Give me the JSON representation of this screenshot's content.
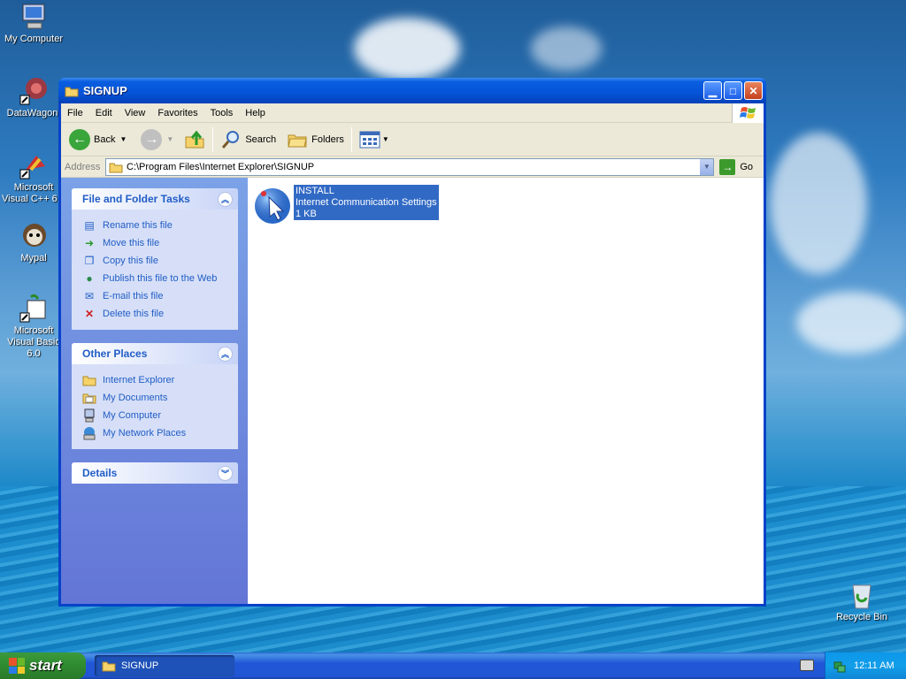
{
  "desktop": {
    "icons": [
      {
        "label": "My Computer",
        "icon": "computer-icon"
      },
      {
        "label": "DataWagon.",
        "icon": "datawagon-icon"
      },
      {
        "label": "Microsoft Visual C++ 6.0",
        "icon": "visual-cpp-icon"
      },
      {
        "label": "Mypal",
        "icon": "mypal-icon"
      },
      {
        "label": "Microsoft Visual Basic 6.0",
        "icon": "visual-basic-icon"
      },
      {
        "label": "Recycle Bin",
        "icon": "recycle-bin-icon"
      }
    ]
  },
  "window": {
    "title": "SIGNUP",
    "menu": [
      "File",
      "Edit",
      "View",
      "Favorites",
      "Tools",
      "Help"
    ],
    "toolbar": {
      "back": "Back",
      "search": "Search",
      "folders": "Folders"
    },
    "address": {
      "label": "Address",
      "value": "C:\\Program Files\\Internet Explorer\\SIGNUP",
      "go": "Go"
    },
    "panels": {
      "file_tasks": {
        "title": "File and Folder Tasks",
        "items": [
          "Rename this file",
          "Move this file",
          "Copy this file",
          "Publish this file to the Web",
          "E-mail this file",
          "Delete this file"
        ]
      },
      "other_places": {
        "title": "Other Places",
        "items": [
          "Internet Explorer",
          "My Documents",
          "My Computer",
          "My Network Places"
        ]
      },
      "details": {
        "title": "Details"
      }
    },
    "file": {
      "name": "INSTALL",
      "type": "Internet Communication Settings",
      "size": "1 KB"
    }
  },
  "taskbar": {
    "start": "start",
    "task": "SIGNUP",
    "clock": "12:11 AM"
  },
  "colors": {
    "xp_blue": "#0842c8",
    "link_blue": "#215dc6",
    "selection": "#316ac5"
  }
}
